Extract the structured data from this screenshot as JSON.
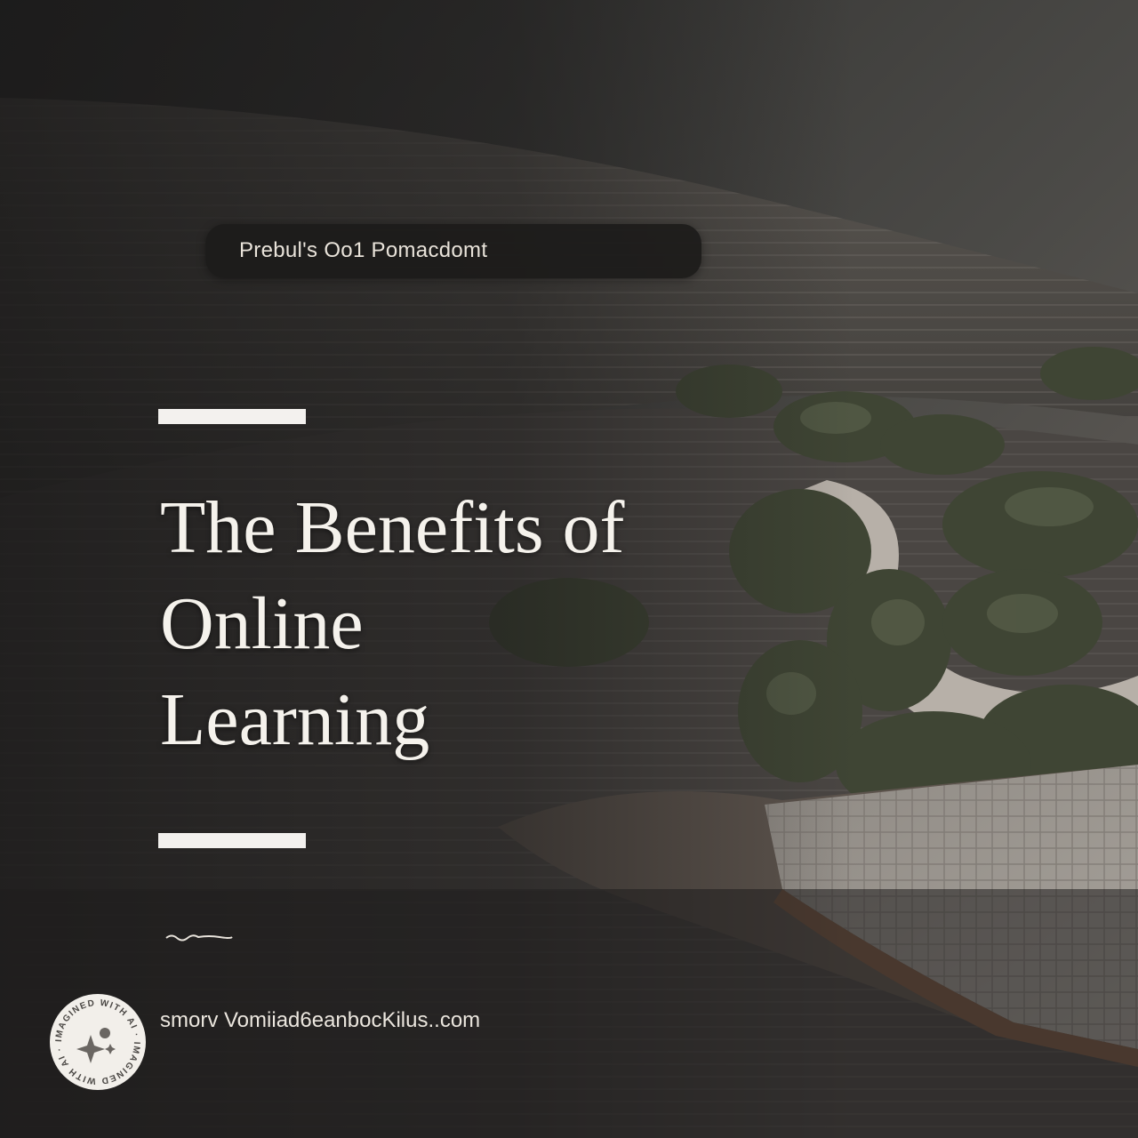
{
  "tag_label": "Prebul's Oo1 Pomacdomt",
  "headline": {
    "line1": "The Benefits of",
    "line2": "Online",
    "line3": "Learning"
  },
  "website": "smorv Vomiiad6eanbocKilus..com",
  "badge_text": "IMAGINED WITH AI · IMAGINED WITH AI ·",
  "colors": {
    "background": "#2b2a29",
    "pill": "#1c1b1a",
    "text": "#f5f2ec",
    "bar": "#f3f1ee"
  },
  "icons": [
    "sparkle-icon"
  ]
}
